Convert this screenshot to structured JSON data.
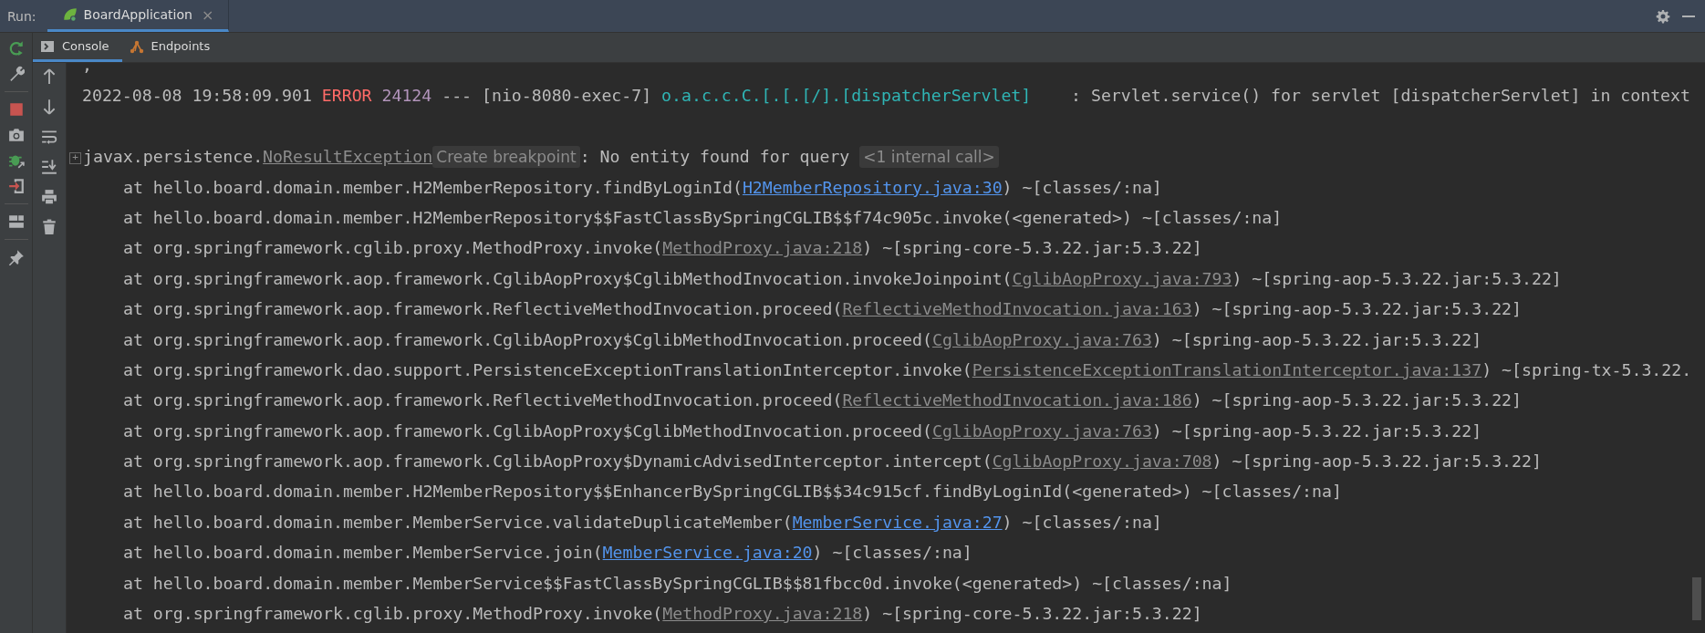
{
  "run_bar": {
    "label": "Run:",
    "tabs": [
      {
        "label": "BoardApplication",
        "selected": true,
        "close": "×"
      }
    ]
  },
  "console_tabs": [
    {
      "label": "Console",
      "kind": "console",
      "selected": true
    },
    {
      "label": "Endpoints",
      "kind": "endpoints",
      "selected": false
    }
  ],
  "console": {
    "lines": [
      {
        "kind": "text",
        "text": ","
      },
      {
        "kind": "log",
        "segments": [
          {
            "kind": "plain",
            "text": "2022-08-08 19:58:09.901 "
          },
          {
            "kind": "level",
            "text": "ERROR"
          },
          {
            "kind": "pid",
            "text": "24124"
          },
          {
            "kind": "plain",
            "text": " --- [nio-8080-exec-7] "
          },
          {
            "kind": "logger",
            "text": "o.a.c.c.C.[.[.[/].[dispatcherServlet]"
          },
          {
            "kind": "plain",
            "text": "    : Servlet.service() for servlet [dispatcherServlet] in context"
          }
        ]
      },
      {
        "kind": "blank"
      },
      {
        "kind": "exception",
        "expander": "+",
        "package": "javax.persistence.",
        "class_name": "NoResultException",
        "hint": "Create breakpoint",
        "message": ": No entity found for query ",
        "folded": "<1 internal call>"
      },
      {
        "kind": "frame",
        "prefix": "at hello.board.domain.member.H2MemberRepository.findByLoginId(",
        "source": {
          "text": "H2MemberRepository.java:30",
          "kind": "project"
        },
        "suffix": ") ~[classes/:na]"
      },
      {
        "kind": "frame",
        "prefix": "at hello.board.domain.member.H2MemberRepository$$FastClassBySpringCGLIB$$f74c905c.invoke(<generated>) ~[classes/:na]"
      },
      {
        "kind": "frame",
        "prefix": "at org.springframework.cglib.proxy.MethodProxy.invoke(",
        "source": {
          "text": "MethodProxy.java:218",
          "kind": "library"
        },
        "suffix": ") ~[spring-core-5.3.22.jar:5.3.22]"
      },
      {
        "kind": "frame",
        "prefix": "at org.springframework.aop.framework.CglibAopProxy$CglibMethodInvocation.invokeJoinpoint(",
        "source": {
          "text": "CglibAopProxy.java:793",
          "kind": "library"
        },
        "suffix": ") ~[spring-aop-5.3.22.jar:5.3.22]"
      },
      {
        "kind": "frame",
        "prefix": "at org.springframework.aop.framework.ReflectiveMethodInvocation.proceed(",
        "source": {
          "text": "ReflectiveMethodInvocation.java:163",
          "kind": "library"
        },
        "suffix": ") ~[spring-aop-5.3.22.jar:5.3.22]"
      },
      {
        "kind": "frame",
        "prefix": "at org.springframework.aop.framework.CglibAopProxy$CglibMethodInvocation.proceed(",
        "source": {
          "text": "CglibAopProxy.java:763",
          "kind": "library"
        },
        "suffix": ") ~[spring-aop-5.3.22.jar:5.3.22]"
      },
      {
        "kind": "frame",
        "prefix": "at org.springframework.dao.support.PersistenceExceptionTranslationInterceptor.invoke(",
        "source": {
          "text": "PersistenceExceptionTranslationInterceptor.java:137",
          "kind": "library"
        },
        "suffix": ") ~[spring-tx-5.3.22."
      },
      {
        "kind": "frame",
        "prefix": "at org.springframework.aop.framework.ReflectiveMethodInvocation.proceed(",
        "source": {
          "text": "ReflectiveMethodInvocation.java:186",
          "kind": "library"
        },
        "suffix": ") ~[spring-aop-5.3.22.jar:5.3.22]"
      },
      {
        "kind": "frame",
        "prefix": "at org.springframework.aop.framework.CglibAopProxy$CglibMethodInvocation.proceed(",
        "source": {
          "text": "CglibAopProxy.java:763",
          "kind": "library"
        },
        "suffix": ") ~[spring-aop-5.3.22.jar:5.3.22]"
      },
      {
        "kind": "frame",
        "prefix": "at org.springframework.aop.framework.CglibAopProxy$DynamicAdvisedInterceptor.intercept(",
        "source": {
          "text": "CglibAopProxy.java:708",
          "kind": "library"
        },
        "suffix": ") ~[spring-aop-5.3.22.jar:5.3.22]"
      },
      {
        "kind": "frame",
        "prefix": "at hello.board.domain.member.H2MemberRepository$$EnhancerBySpringCGLIB$$34c915cf.findByLoginId(<generated>) ~[classes/:na]"
      },
      {
        "kind": "frame",
        "prefix": "at hello.board.domain.member.MemberService.validateDuplicateMember(",
        "source": {
          "text": "MemberService.java:27",
          "kind": "project"
        },
        "suffix": ") ~[classes/:na]"
      },
      {
        "kind": "frame",
        "prefix": "at hello.board.domain.member.MemberService.join(",
        "source": {
          "text": "MemberService.java:20",
          "kind": "project"
        },
        "suffix": ") ~[classes/:na]"
      },
      {
        "kind": "frame",
        "prefix": "at hello.board.domain.member.MemberService$$FastClassBySpringCGLIB$$81fbcc0d.invoke(<generated>) ~[classes/:na]"
      },
      {
        "kind": "frame",
        "prefix": "at org.springframework.cglib.proxy.MethodProxy.invoke(",
        "source": {
          "text": "MethodProxy.java:218",
          "kind": "library"
        },
        "suffix": ") ~[spring-core-5.3.22.jar:5.3.22]"
      }
    ]
  }
}
